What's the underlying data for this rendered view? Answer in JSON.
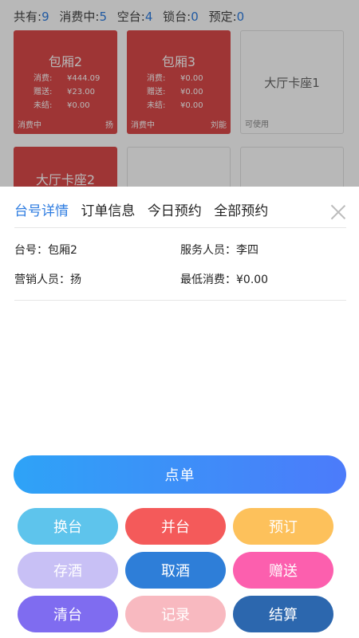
{
  "stats": [
    {
      "label": "共有:",
      "value": "9"
    },
    {
      "label": "消费中:",
      "value": "5"
    },
    {
      "label": "空台:",
      "value": "4"
    },
    {
      "label": "锁台:",
      "value": "0"
    },
    {
      "label": "预定:",
      "value": "0"
    }
  ],
  "tables": [
    {
      "name": "包厢2",
      "status": "消费中",
      "staff": "扬",
      "rows": [
        {
          "label": "消费:",
          "value": "¥444.09"
        },
        {
          "label": "赠送:",
          "value": "¥23.00"
        },
        {
          "label": "未结:",
          "value": "¥0.00"
        }
      ]
    },
    {
      "name": "包厢3",
      "status": "消费中",
      "staff": "刘能",
      "rows": [
        {
          "label": "消费:",
          "value": "¥0.00"
        },
        {
          "label": "赠送:",
          "value": "¥0.00"
        },
        {
          "label": "未结:",
          "value": "¥0.00"
        }
      ]
    },
    {
      "name": "大厅卡座1",
      "status": "可使用"
    },
    {
      "name": "大厅卡座2"
    }
  ],
  "tabs": [
    "台号详情",
    "订单信息",
    "今日预约",
    "全部预约"
  ],
  "details": {
    "table_no": "台号：包厢2",
    "server": "服务人员：李四",
    "marketer": "营销人员：扬",
    "min_spend": "最低消费：¥0.00"
  },
  "order_button": "点单",
  "actions": [
    {
      "label": "换台",
      "color": "#5ec4ec"
    },
    {
      "label": "并台",
      "color": "#f45a5a"
    },
    {
      "label": "预订",
      "color": "#fdc15b"
    },
    {
      "label": "存酒",
      "color": "#c8c0f5"
    },
    {
      "label": "取酒",
      "color": "#2e7ed8"
    },
    {
      "label": "赠送",
      "color": "#fc5fae"
    },
    {
      "label": "清台",
      "color": "#7f6cf0"
    },
    {
      "label": "记录",
      "color": "#f8b9c0"
    },
    {
      "label": "结算",
      "color": "#2c67ae"
    }
  ]
}
